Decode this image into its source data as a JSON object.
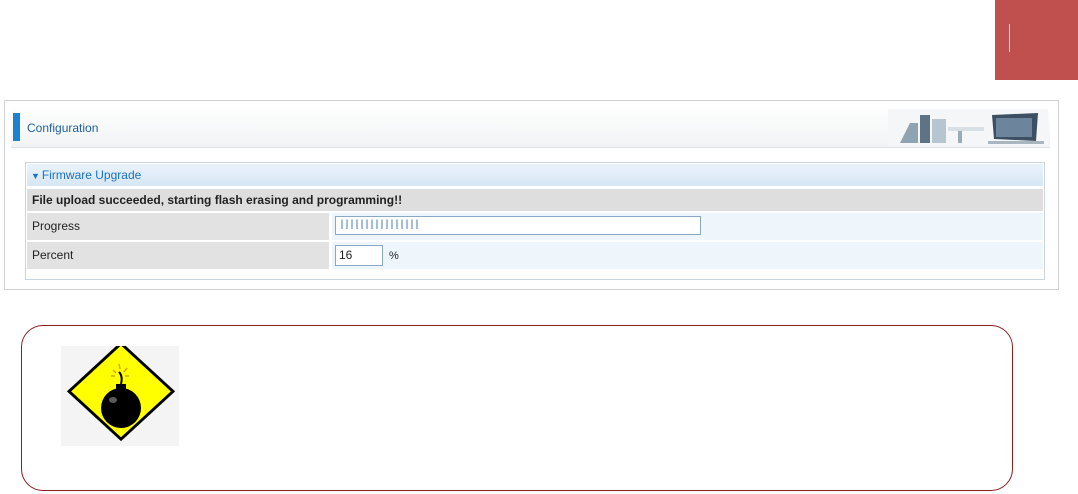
{
  "panel": {
    "title": "Configuration"
  },
  "firmware": {
    "section_title": "Firmware Upgrade",
    "status_message": "File upload succeeded, starting flash erasing and programming!!",
    "progress_label": "Progress",
    "progress_value": "||||||||||||||||",
    "percent_label": "Percent",
    "percent_value": "16",
    "percent_unit": "%"
  },
  "colors": {
    "accent_blue": "#1b82d1",
    "corner_tab": "#c0504d",
    "warning_border": "#8b1e1e",
    "bomb_yellow": "#ffff00"
  },
  "icons": {
    "warning": "bomb-warning-icon",
    "section_toggle": "triangle-down-icon"
  }
}
